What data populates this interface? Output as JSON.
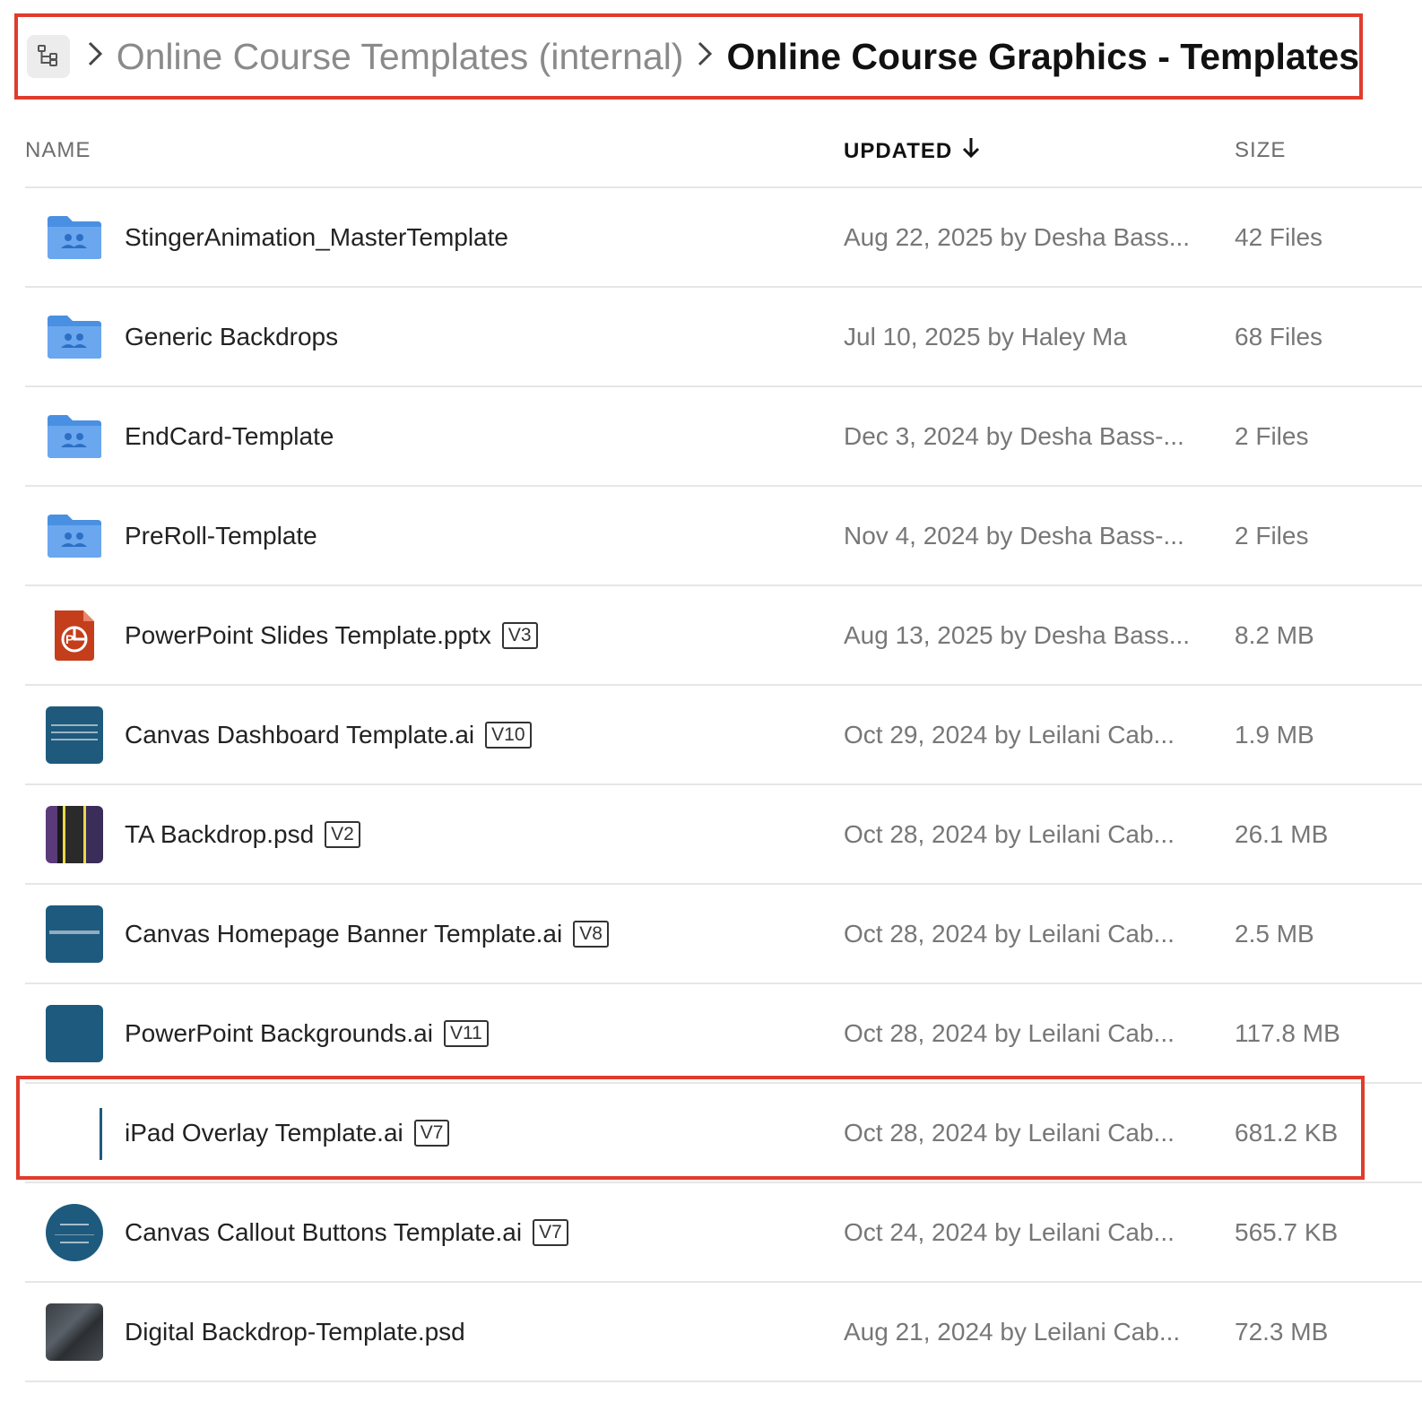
{
  "breadcrumb": {
    "parent": "Online Course Templates (internal)",
    "current": "Online Course Graphics - Templates"
  },
  "columns": {
    "name": "NAME",
    "updated": "UPDATED",
    "size": "SIZE"
  },
  "rows": [
    {
      "name": "StingerAnimation_MasterTemplate",
      "version": "",
      "updated": "Aug 22, 2025 by Desha Bass...",
      "size": "42 Files",
      "type": "shared-folder-icon"
    },
    {
      "name": "Generic Backdrops",
      "version": "",
      "updated": "Jul 10, 2025 by Haley Ma",
      "size": "68 Files",
      "type": "shared-folder-icon"
    },
    {
      "name": "EndCard-Template",
      "version": "",
      "updated": "Dec 3, 2024 by Desha Bass-...",
      "size": "2 Files",
      "type": "shared-folder-icon"
    },
    {
      "name": "PreRoll-Template",
      "version": "",
      "updated": "Nov 4, 2024 by Desha Bass-...",
      "size": "2 Files",
      "type": "shared-folder-icon"
    },
    {
      "name": "PowerPoint Slides Template.pptx",
      "version": "V3",
      "updated": "Aug 13, 2025 by Desha Bass...",
      "size": "8.2 MB",
      "type": "powerpoint-file-icon"
    },
    {
      "name": "Canvas Dashboard Template.ai",
      "version": "V10",
      "updated": "Oct 29, 2024 by Leilani Cab...",
      "size": "1.9 MB",
      "type": "image-thumbnail"
    },
    {
      "name": "TA Backdrop.psd",
      "version": "V2",
      "updated": "Oct 28, 2024 by Leilani Cab...",
      "size": "26.1 MB",
      "type": "image-thumbnail"
    },
    {
      "name": "Canvas Homepage Banner Template.ai",
      "version": "V8",
      "updated": "Oct 28, 2024 by Leilani Cab...",
      "size": "2.5 MB",
      "type": "image-thumbnail"
    },
    {
      "name": "PowerPoint Backgrounds.ai",
      "version": "V11",
      "updated": "Oct 28, 2024 by Leilani Cab...",
      "size": "117.8 MB",
      "type": "image-thumbnail"
    },
    {
      "name": "iPad Overlay Template.ai",
      "version": "V7",
      "updated": "Oct 28, 2024 by Leilani Cab...",
      "size": "681.2 KB",
      "type": "image-thumbnail"
    },
    {
      "name": "Canvas Callout Buttons Template.ai",
      "version": "V7",
      "updated": "Oct 24, 2024 by Leilani Cab...",
      "size": "565.7 KB",
      "type": "image-thumbnail"
    },
    {
      "name": "Digital Backdrop-Template.psd",
      "version": "",
      "updated": "Aug 21, 2024 by Leilani Cab...",
      "size": "72.3 MB",
      "type": "image-thumbnail"
    }
  ],
  "colors": {
    "highlight": "#e03c2d",
    "folder": "#4a90e2",
    "powerpoint": "#c43e1c"
  }
}
